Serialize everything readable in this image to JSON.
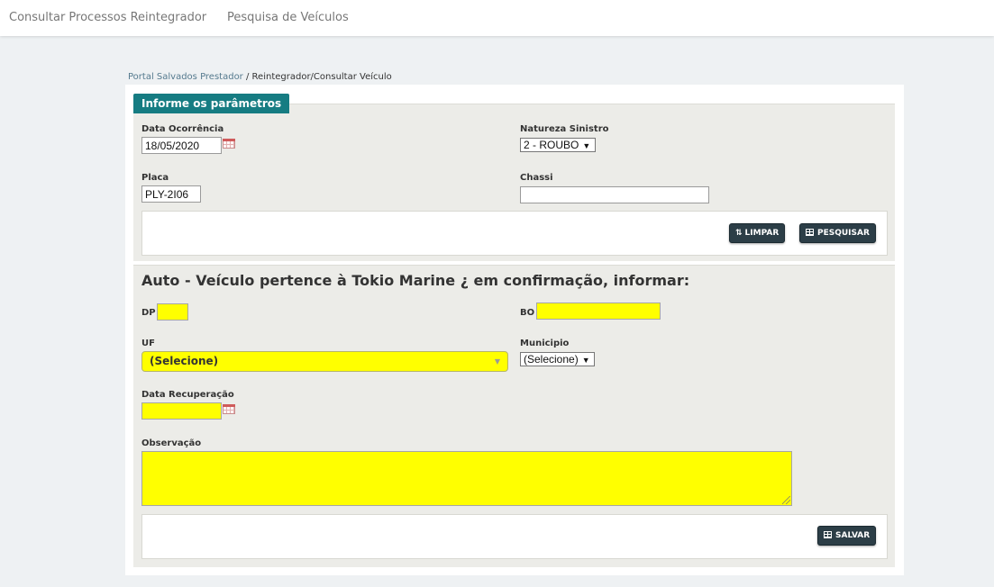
{
  "nav": {
    "item1": "Consultar Processos Reintegrador",
    "item2": "Pesquisa de Veículos"
  },
  "breadcrumb": {
    "root": "Portal Salvados Prestador",
    "separator": " / ",
    "current": "Reintegrador/Consultar Veículo"
  },
  "params": {
    "tab_label": "Informe os parâmetros",
    "data_ocorrencia": {
      "label": "Data Ocorrência",
      "value": "18/05/2020"
    },
    "natureza_sinistro": {
      "label": "Natureza Sinistro",
      "value": "2 - ROUBO"
    },
    "placa": {
      "label": "Placa",
      "value": "PLY-2I06"
    },
    "chassi": {
      "label": "Chassi",
      "value": ""
    },
    "limpar_label": "LIMPAR",
    "pesquisar_label": "PESQUISAR"
  },
  "confirm": {
    "title": "Auto - Veículo pertence à Tokio Marine ¿ em confirmação, informar:",
    "dp": {
      "label": "DP",
      "value": ""
    },
    "bo": {
      "label": "BO",
      "value": ""
    },
    "uf": {
      "label": "UF",
      "value": "(Selecione)"
    },
    "municipio": {
      "label": "Municipio",
      "value": "(Selecione)"
    },
    "data_recuperacao": {
      "label": "Data Recuperação",
      "value": ""
    },
    "observacao": {
      "label": "Observação",
      "value": ""
    },
    "salvar_label": "SALVAR"
  },
  "icons": {
    "limpar": "swap-vertical-icon",
    "pesquisar": "table-icon",
    "salvar": "table-icon",
    "calendar": "calendar-icon",
    "dropdown": "caret-down-icon"
  },
  "colors": {
    "tab_bg": "#167c82",
    "panel_bg": "#ecece8",
    "button_bg": "#2c3e47",
    "required_field": "#ffff00",
    "link": "#557a8e"
  }
}
